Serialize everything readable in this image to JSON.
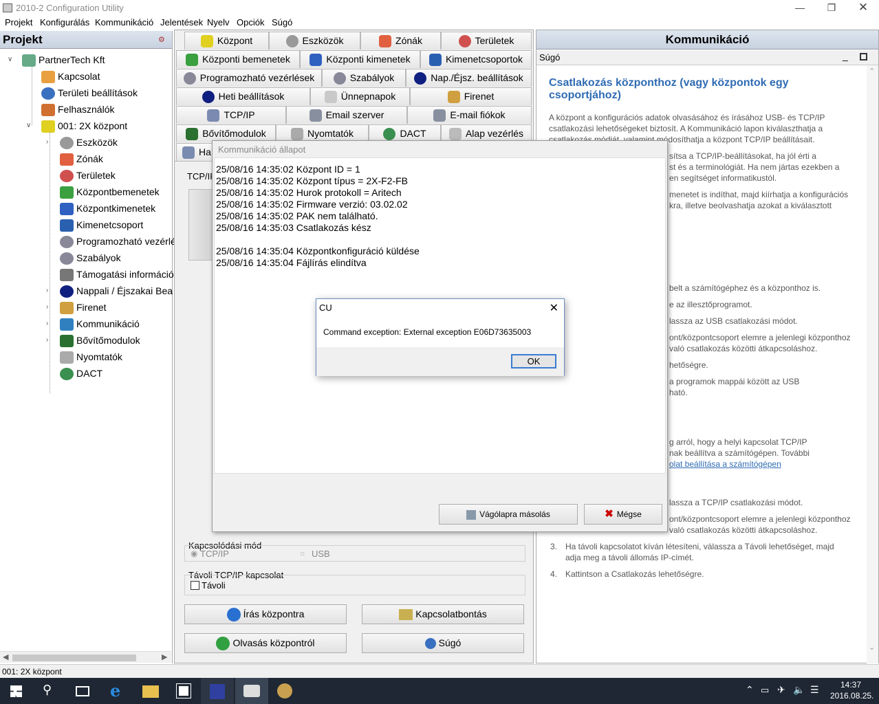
{
  "window": {
    "title": "2010-2 Configuration Utility"
  },
  "menu": [
    "Projekt",
    "Konfigurálás",
    "Kommunikáció",
    "Jelentések",
    "Nyelv",
    "Opciók",
    "Súgó"
  ],
  "left": {
    "header": "Projekt",
    "tree": [
      {
        "label": "PartnerTech Kft",
        "color": "#6a8"
      },
      {
        "label": "Kapcsolat",
        "color": "#e8a040"
      },
      {
        "label": "Területi beállítások",
        "color": "#3a70c0"
      },
      {
        "label": "Felhasználók",
        "color": "#d07030"
      },
      {
        "label": "001: 2X központ",
        "color": "#e0d020"
      },
      {
        "label": "Eszközök",
        "color": "#999"
      },
      {
        "label": "Zónák",
        "color": "#e06040"
      },
      {
        "label": "Területek",
        "color": "#d05050"
      },
      {
        "label": "Központbemenetek",
        "color": "#3aa040"
      },
      {
        "label": "Központkimenetek",
        "color": "#3060c0"
      },
      {
        "label": "Kimenetcsoport",
        "color": "#2a60b0"
      },
      {
        "label": "Programozható vezérlé",
        "color": "#889"
      },
      {
        "label": "Szabályok",
        "color": "#889"
      },
      {
        "label": "Támogatási információl",
        "color": "#777"
      },
      {
        "label": "Nappali / Éjszakai  Bea",
        "color": "#102080"
      },
      {
        "label": "Firenet",
        "color": "#d0a040"
      },
      {
        "label": "Kommunikáció",
        "color": "#3080c0"
      },
      {
        "label": "Bővítőmodulok",
        "color": "#2a7030"
      },
      {
        "label": "Nyomtatók",
        "color": "#aaa"
      },
      {
        "label": "DACT",
        "color": "#3a9050"
      }
    ]
  },
  "tabs": {
    "row1": [
      "Központ",
      "Eszközök",
      "Zónák",
      "Területek"
    ],
    "row2": [
      "Központi bemenetek",
      "Központi kimenetek",
      "Kimenetcsoportok"
    ],
    "row3": [
      "Programozható vezérlések",
      "Szabályok",
      "Nap./Éjsz. beállítások"
    ],
    "row4": [
      "Heti beállítások",
      "Ünnepnapok",
      "Firenet"
    ],
    "row5": [
      "TCP/IP",
      "Email szerver",
      "E-mail fiókok"
    ],
    "row6": [
      "Bővítőmodulok",
      "Nyomtatók",
      "DACT",
      "Alap vezérlés"
    ],
    "row7_partial": "Ha",
    "tcp_partial": "TCP/IF"
  },
  "conn": {
    "mode_label": "Kapcsolódási mód",
    "tcp": "TCP/IP",
    "usb": "USB",
    "remote_group": "Távoli TCP/IP kapcsolat",
    "remote_check": "Távoli",
    "write": "Írás központra",
    "disconnect": "Kapcsolatbontás",
    "read": "Olvasás központról",
    "help": "Súgó"
  },
  "right": {
    "header": "Kommunikáció",
    "sugo": "Súgó",
    "title1": "Csatlakozás központhoz (vagy központok egy",
    "title2": "csoportjához)",
    "lines": [
      "A központ a konfigurációs adatok olvasásához és írásához USB- és TCP/IP",
      "csatlakozási lehetőségeket biztosít. A Kommunikáció lapon kiválaszthatja a",
      "csatlakozás módját, valamint módosíthatja a központ TCP/IP beállításait.",
      "sítsa a TCP/IP-beállításokat, ha jól érti a",
      "st és a terminológiát. Ha nem jártas ezekben a",
      "en segítséget informatikustól.",
      "menetet is indíthat, majd kiírhatja a konfigurációs",
      "kra, illetve beolvashatja azokat a kiválasztott",
      "belt a számítógéphez és a központhoz is.",
      "e az illesztőprogramot.",
      "lassza az USB csatlakozási módot.",
      "ont/központcsoport elemre a jelenlegi központhoz",
      "való csatlakozás közötti átkapcsoláshoz.",
      "hetőségre.",
      "a programok mappái között az USB",
      "ható.",
      "g arról, hogy a helyi kapcsolat TCP/IP",
      "nak beállítva a számítógépen. További",
      "olat beállítása a számítógépen",
      "lassza a TCP/IP csatlakozási módot.",
      "ont/központcsoport elemre a jelenlegi központhoz",
      "való csatlakozás közötti átkapcsoláshoz.",
      "Ha távoli kapcsolatot kíván létesíteni, válassza a Távoli lehetőséget, majd",
      "adja meg a távoli állomás IP-címét.",
      "Kattintson a Csatlakozás lehetőségre."
    ],
    "num3": "3.",
    "num4": "4."
  },
  "comm_dialog": {
    "title": "Kommunikáció állapot",
    "log": [
      "25/08/16 14:35:02 Központ ID = 1",
      "25/08/16 14:35:02 Központ típus = 2X-F2-FB",
      "25/08/16 14:35:02 Hurok protokoll = Aritech",
      "25/08/16 14:35:02 Firmware verzió: 03.02.02",
      "25/08/16 14:35:02 PAK nem található.",
      "25/08/16 14:35:03 Csatlakozás kész",
      "25/08/16 14:35:04 Központkonfiguráció küldése",
      "25/08/16 14:35:04 Fájlírás elindítva"
    ],
    "copy": "Vágólapra másolás",
    "cancel": "Mégse"
  },
  "cu_dialog": {
    "title": "CU",
    "message": "Command exception: External exception E06D73635003",
    "ok": "OK"
  },
  "status": "001: 2X központ",
  "clock": {
    "time": "14:37",
    "date": "2016.08.25."
  }
}
